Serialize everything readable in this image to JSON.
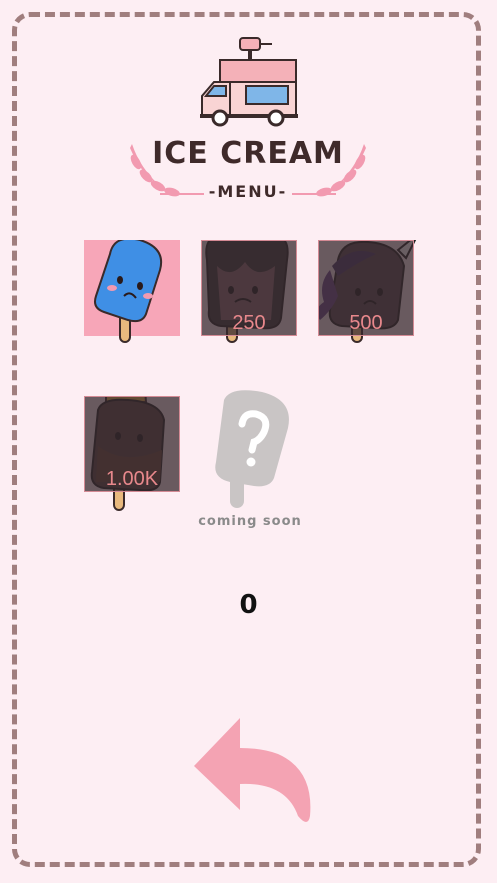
{
  "header": {
    "title": "ICE CREAM",
    "subtitle": "-MENU-"
  },
  "items": [
    {
      "name": "blue-popsicle",
      "state": "selected",
      "price": ""
    },
    {
      "name": "vampire-popsicle",
      "state": "locked",
      "price": "250"
    },
    {
      "name": "unicorn-popsicle",
      "state": "locked",
      "price": "500"
    },
    {
      "name": "king-popsicle",
      "state": "locked",
      "price": "1.00K"
    }
  ],
  "coming_soon": {
    "label": "coming soon",
    "icon": "question-mark-icon"
  },
  "score": "0",
  "back_button": {
    "icon": "back-arrow-icon"
  },
  "colors": {
    "background": "#fdeef3",
    "frame": "#a07e7e",
    "selected_bg": "#f7a6b8",
    "price": "#e8888c",
    "back_arrow": "#f4a3b3"
  }
}
